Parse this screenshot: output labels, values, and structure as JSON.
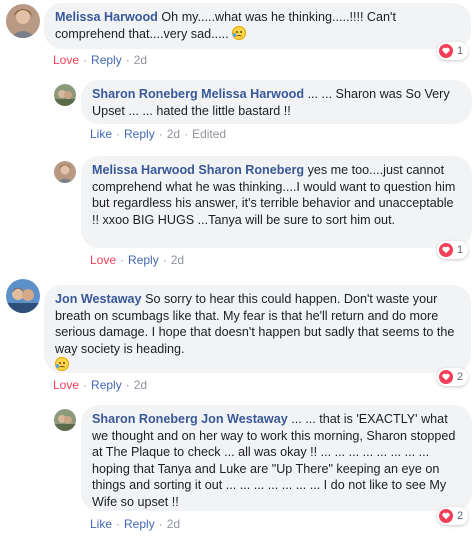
{
  "comments": [
    {
      "author": "Melissa Harwood",
      "text": "Oh my.....what was he thinking.....!!!! Can't comprehend that....very sad.....",
      "emoji": "crying-face",
      "actions": {
        "love": "Love",
        "reply": "Reply",
        "time": "2d"
      },
      "reaction": {
        "icon": "heart",
        "count": "1"
      }
    },
    {
      "author": "Sharon Roneberg",
      "tag": "Melissa Harwood",
      "text": "... ... Sharon was So Very Upset ... ... hated the little bastard !!",
      "actions": {
        "like": "Like",
        "reply": "Reply",
        "time": "2d",
        "edited": "Edited"
      }
    },
    {
      "author": "Melissa Harwood",
      "tag": "Sharon Roneberg",
      "text": "yes me too....just cannot comprehend what he was thinking....I would want to question him but regardless his answer, it's terrible behavior and unacceptable !! xxoo BIG HUGS ...Tanya will be sure to sort him out.",
      "actions": {
        "love": "Love",
        "reply": "Reply",
        "time": "2d"
      },
      "reaction": {
        "icon": "heart",
        "count": "1"
      }
    },
    {
      "author": "Jon Westaway",
      "text": "So sorry to hear this could happen. Don't waste your breath on scumbags like that. My fear is that he'll return and do more serious damage. I hope that doesn't happen but sadly that seems to the way society is heading.",
      "emoji": "crying-face",
      "actions": {
        "love": "Love",
        "reply": "Reply",
        "time": "2d"
      },
      "reaction": {
        "icon": "heart",
        "count": "2"
      }
    },
    {
      "author": "Sharon Roneberg",
      "tag": "Jon Westaway",
      "text": "... ... that is 'EXACTLY' what we thought and on her way to work this morning, Sharon stopped at The Plaque to check ... all was okay !! ... ... ... ... ... ... ... ... hoping that Tanya and Luke are \"Up There\" keeping an eye on things and sorting it out ... ... ... ... ... ... ... I do not like to see My Wife so upset !!",
      "actions": {
        "like": "Like",
        "reply": "Reply",
        "time": "2d"
      },
      "reaction": {
        "icon": "heart",
        "count": "2"
      }
    }
  ],
  "colors": {
    "author": "#385898",
    "link": "#4267b2",
    "love": "#f33e58",
    "bubble": "#f2f3f5",
    "meta": "#90949c"
  }
}
